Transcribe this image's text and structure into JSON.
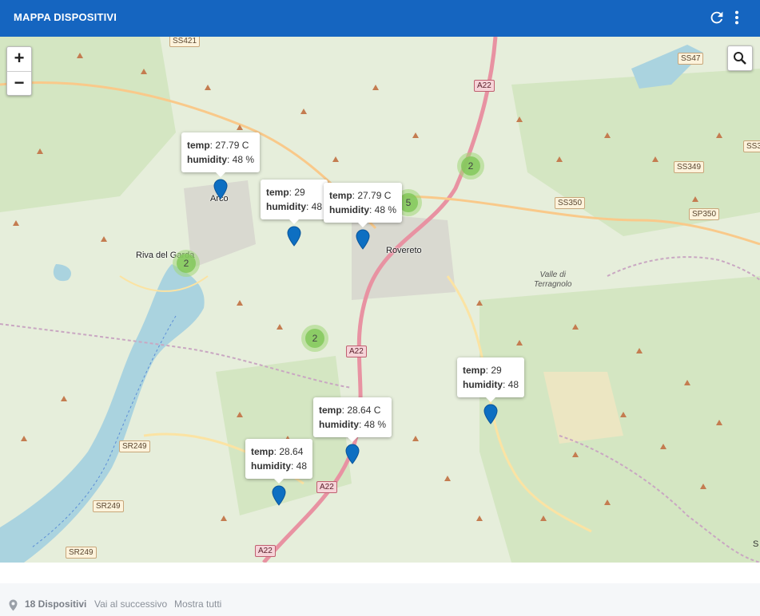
{
  "header": {
    "title": "MAPPA DISPOSITIVI",
    "accent": "#1565c0"
  },
  "map": {
    "zoom_in": "+",
    "zoom_out": "−",
    "towns": [
      "Arco",
      "Riva del Garda",
      "Rovereto"
    ],
    "valley": [
      "Valle di",
      "Terragnolo"
    ],
    "roads": [
      "SS421",
      "A22",
      "SS47",
      "SS3",
      "SS349",
      "SS350",
      "SP350",
      "A22",
      "SR249",
      "A22",
      "SR249",
      "SR249",
      "A22",
      "S"
    ],
    "clusters": [
      "2",
      "5",
      "2",
      "2"
    ],
    "popups": [
      {
        "temp_label": "temp",
        "temp": ": 27.79 C",
        "hum_label": "humidity",
        "hum": ": 48 %"
      },
      {
        "temp_label": "temp",
        "temp": ": 29",
        "hum_label": "humidity",
        "hum": ": 48"
      },
      {
        "temp_label": "temp",
        "temp": ": 27.79 C",
        "hum_label": "humidity",
        "hum": ": 48 %"
      },
      {
        "temp_label": "temp",
        "temp": ": 29",
        "hum_label": "humidity",
        "hum": ": 48"
      },
      {
        "temp_label": "temp",
        "temp": ": 28.64 C",
        "hum_label": "humidity",
        "hum": ": 48 %"
      },
      {
        "temp_label": "temp",
        "temp": ": 28.64",
        "hum_label": "humidity",
        "hum": ": 48"
      }
    ]
  },
  "footer": {
    "count": "18 Dispositivi",
    "next": "Vai al successivo",
    "all": "Mostra tutti"
  },
  "colors": {
    "marker": "#0d6fc2",
    "water": "#aad3df",
    "land": "#e6eedb"
  }
}
